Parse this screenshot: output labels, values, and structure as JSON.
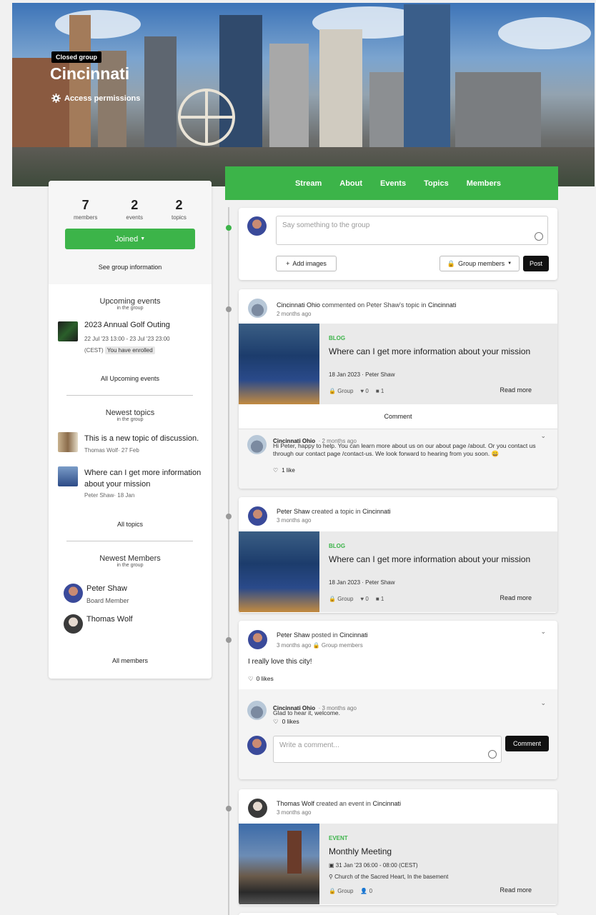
{
  "hero": {
    "badge": "Closed group",
    "title": "Cincinnati",
    "access": "Access permissions"
  },
  "nav": [
    "Stream",
    "About",
    "Events",
    "Topics",
    "Members"
  ],
  "side": {
    "stats": [
      {
        "value": "7",
        "label": "members"
      },
      {
        "value": "2",
        "label": "events"
      },
      {
        "value": "2",
        "label": "topics"
      }
    ],
    "joined": "Joined",
    "see_info": "See group information",
    "upcoming_title": "Upcoming events",
    "upcoming_sub": "in the group",
    "event": {
      "title": "2023 Annual Golf Outing",
      "date": "22 Jul '23 13:00 - 23 Jul '23 23:00",
      "tz": "(CEST)",
      "status": "You have enrolled"
    },
    "all_events": "All Upcoming events",
    "topics_title": "Newest topics",
    "topics_sub": "in the group",
    "topics": [
      {
        "title": "This is a new topic of discussion.",
        "meta": "Thomas Wolf· 27 Feb"
      },
      {
        "title": "Where can I get more information about your mission",
        "meta": "Peter Shaw· 18 Jan"
      }
    ],
    "all_topics": "All topics",
    "members_title": "Newest Members",
    "members_sub": "in the group",
    "members": [
      {
        "name": "Peter Shaw",
        "role": "Board Member"
      },
      {
        "name": "Thomas Wolf",
        "role": ""
      }
    ],
    "all_members": "All members"
  },
  "composer": {
    "placeholder": "Say something to the group",
    "add_images": "Add images",
    "visibility": "Group members",
    "post": "Post"
  },
  "post1": {
    "actor": "Cincinnati Ohio",
    "verb": "commented on",
    "target": "Peter Shaw's topic in",
    "group": "Cincinnati",
    "time": "2 months ago",
    "label": "BLOG",
    "title": "Where can I get more information about your mission",
    "meta": "18 Jan 2023 · Peter Shaw",
    "vis": "Group",
    "likes": "0",
    "comments": "1",
    "read_more": "Read more",
    "comment_btn": "Comment",
    "comment": {
      "name": "Cincinnati Ohio",
      "time": "· 2 months ago",
      "text": "Hi Peter, happy to help. You can learn more about us on our about page /about. Or you contact us through our contact page /contact-us. We look forward to hearing from you soon. 😀",
      "likes": "1 like"
    }
  },
  "post2": {
    "actor": "Peter Shaw",
    "verb": "created a topic in",
    "group": "Cincinnati",
    "time": "3 months ago",
    "label": "BLOG",
    "title": "Where can I get more information about your mission",
    "meta": "18 Jan 2023 · Peter Shaw",
    "vis": "Group",
    "likes": "0",
    "comments": "1",
    "read_more": "Read more"
  },
  "post3": {
    "actor": "Peter Shaw",
    "verb": "posted in",
    "group": "Cincinnati",
    "time": "3 months ago",
    "vis": "Group members",
    "text": "I really love this city!",
    "likes": "0 likes",
    "comment": {
      "name": "Cincinnati Ohio",
      "time": "· 3 months ago",
      "text": "Glad to hear it, welcome.",
      "likes": "0 likes"
    },
    "placeholder": "Write a comment...",
    "comment_btn": "Comment"
  },
  "post4": {
    "actor": "Thomas Wolf",
    "verb": "created an event in",
    "group": "Cincinnati",
    "time": "3 months ago",
    "label": "EVENT",
    "title": "Monthly Meeting",
    "date": "31 Jan '23 06:00 - 08:00 (CEST)",
    "location": "Church of the Sacred Heart, In the basement",
    "vis": "Group",
    "attendees": "0",
    "read_more": "Read more"
  },
  "colors": {
    "accent": "#3cb449",
    "dark": "#111111"
  }
}
